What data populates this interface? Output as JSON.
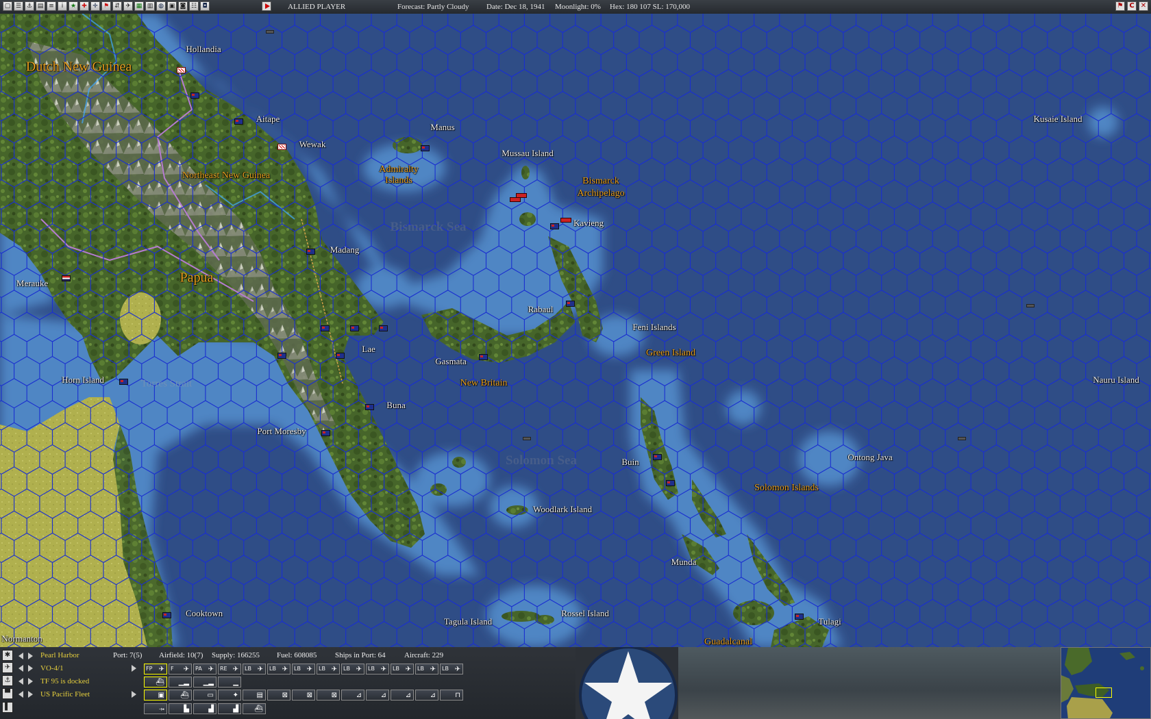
{
  "topbar": {
    "player": "ALLIED PLAYER",
    "forecast": "Forecast: Partly Cloudy",
    "date": "Date: Dec 18, 1941",
    "moonlight": "Moonlight: 0%",
    "hex": "Hex: 180 107  SL: 170,000"
  },
  "map": {
    "regions": {
      "dutch_new_guinea": "Dutch New Guinea",
      "northeast_new_guinea": "Northeast New Guinea",
      "papua": "Papua",
      "admiralty_islands": "Admiralty Islands",
      "bismarck_archipelago": "Bismarck Archipelago",
      "new_britain": "New Britain",
      "solomon_islands": "Solomon Islands",
      "green_island": "Green Island",
      "guadalcanal": "Guadalcanal"
    },
    "seas": {
      "bismarck_sea": "Bismarck Sea",
      "solomon_sea": "Solomon Sea",
      "torres_strait": "Torres Strait"
    },
    "places": {
      "hollandia": "Hollandia",
      "aitape": "Aitape",
      "wewak": "Wewak",
      "manus": "Manus",
      "mussau": "Mussau Island",
      "kavieng": "Kavieng",
      "madang": "Madang",
      "merauke": "Merauke",
      "rabaul": "Rabaul",
      "feni": "Feni Islands",
      "lae": "Lae",
      "gasmata": "Gasmata",
      "horn": "Horn Island",
      "buna": "Buna",
      "port_moresby": "Port Moresby",
      "buin": "Buin",
      "ontong_java": "Ontong Java",
      "woodlark": "Woodlark Island",
      "munda": "Munda",
      "cooktown": "Cooktown",
      "tagula": "Tagula Island",
      "rossel": "Rossel Island",
      "tulagi": "Tulagi",
      "normanton": "Normanton",
      "kusaie": "Kusaie Island",
      "nauru": "Nauru Island"
    }
  },
  "bottom": {
    "base": "Pearl Harbor",
    "port": "Port: 7(5)",
    "airfield": "Airfield: 10(7)",
    "supply": "Supply: 166255",
    "fuel": "Fuel: 608085",
    "ships_in_port": "Ships in Port: 64",
    "aircraft": "Aircraft: 229",
    "unit": "VO-4/1",
    "tf": "TF 95 is docked",
    "command": "US Pacific Fleet",
    "air_buttons": [
      "FP",
      "F",
      "PA",
      "RE",
      "LB",
      "LB",
      "LB",
      "LB",
      "LB",
      "LB",
      "LB",
      "LB",
      "LB"
    ]
  },
  "colors": {
    "ocean": "#2f4d86",
    "shallow": "#4f86c4",
    "hexgrid": "#1a2fd0",
    "jungle": "#4a6a2a",
    "desert": "#b6b652",
    "label_region": "#e8a020",
    "label_yellow": "#e6cf3d"
  }
}
